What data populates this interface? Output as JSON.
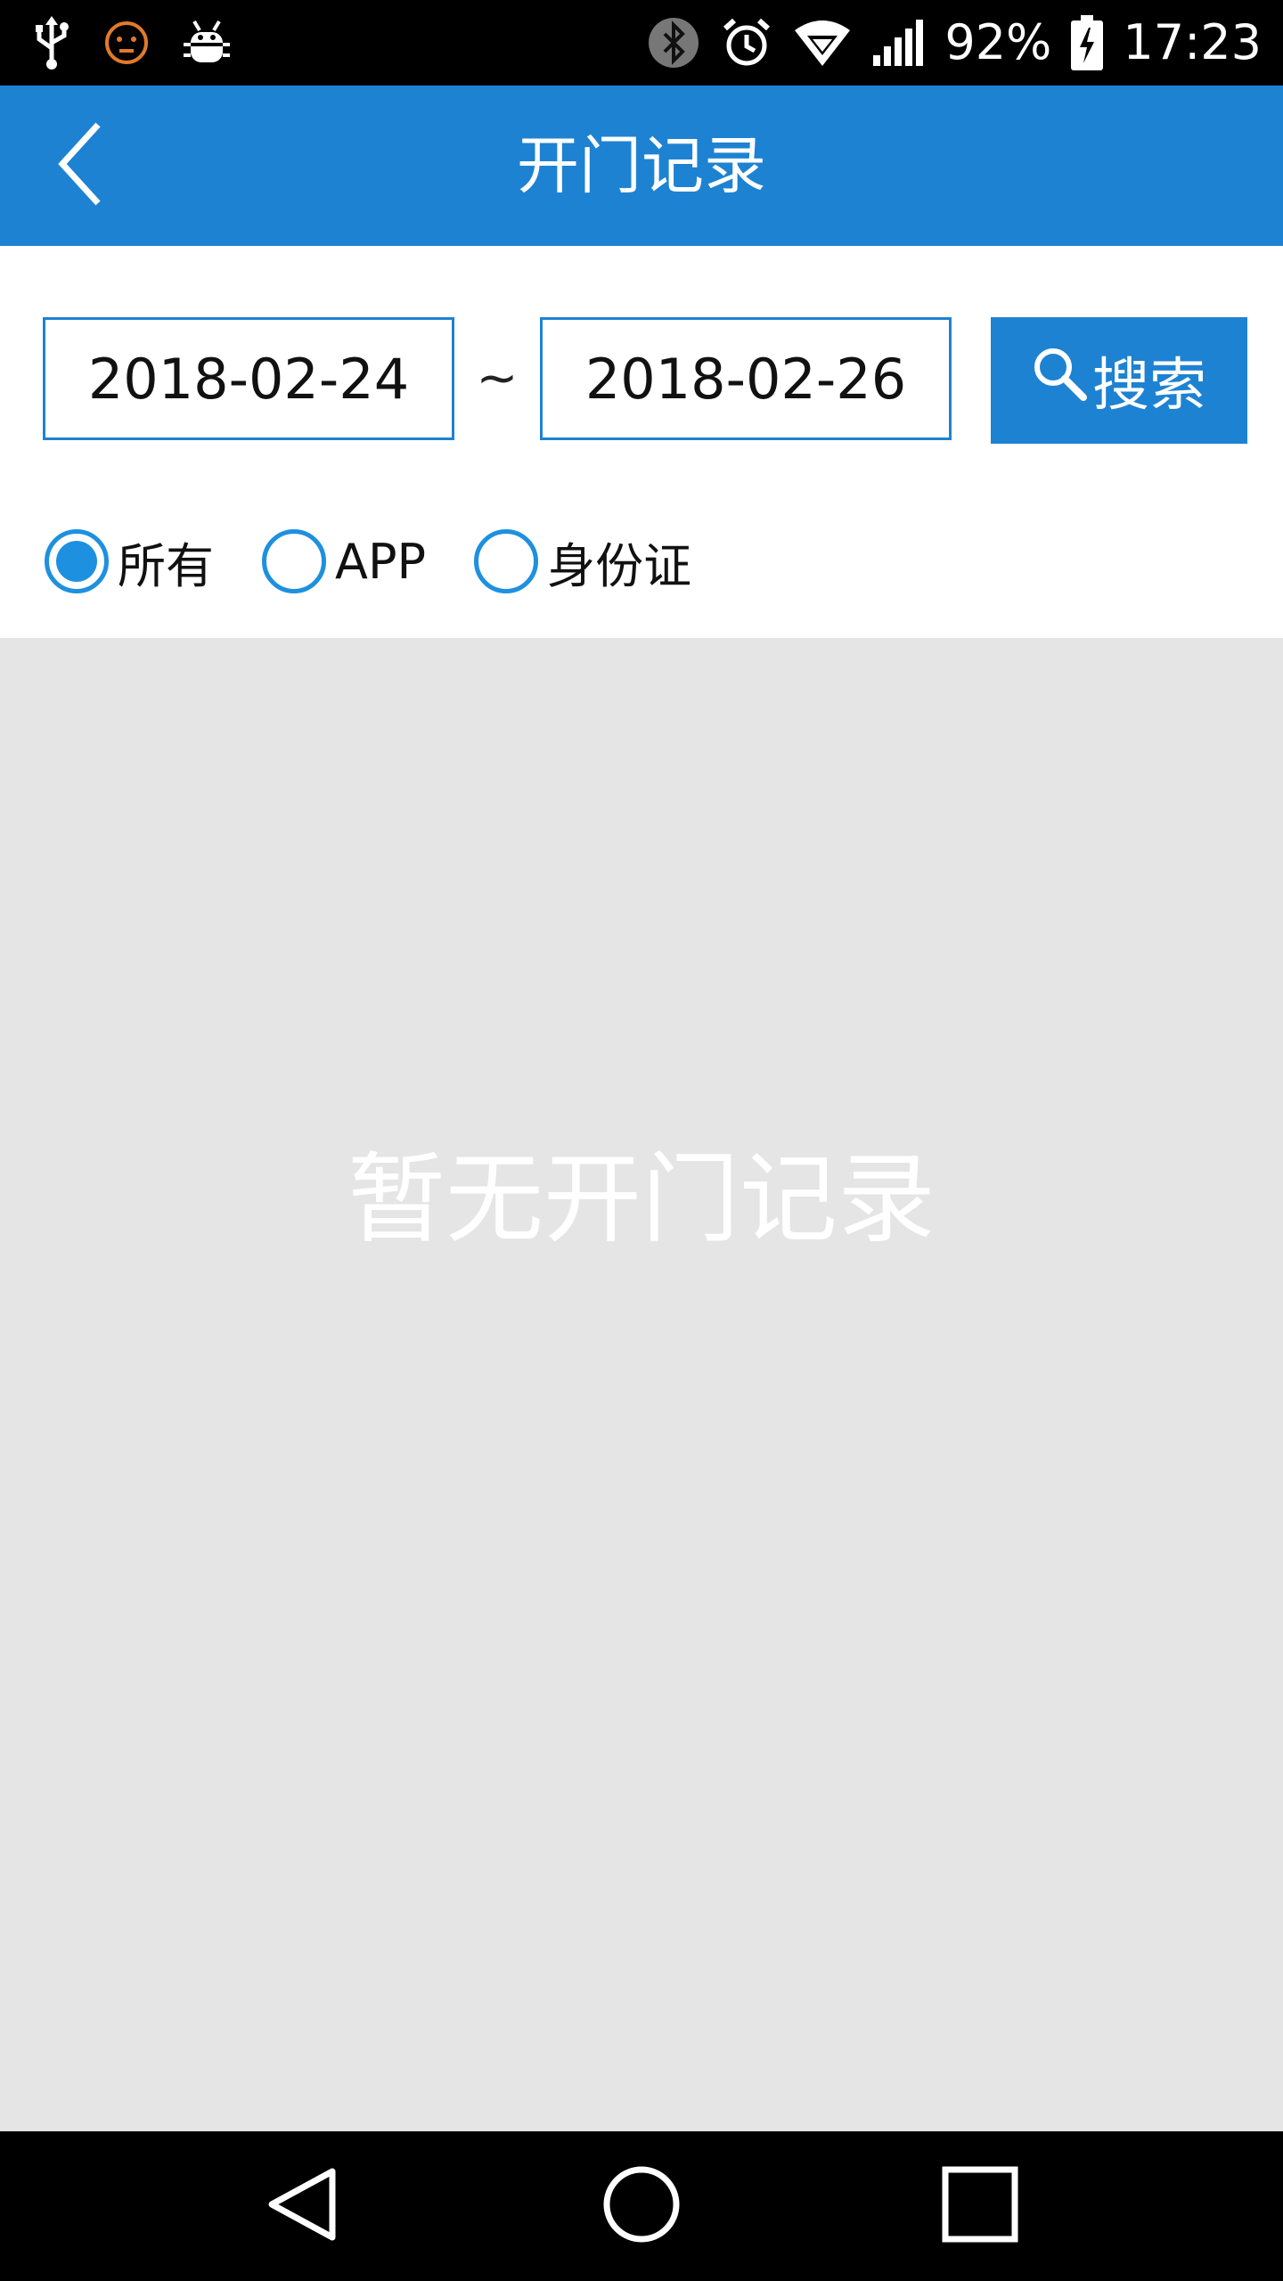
{
  "status_bar": {
    "battery_percent": "92%",
    "time": "17:23",
    "icons": [
      "usb-icon",
      "face-icon",
      "android-debug-icon",
      "bluetooth-icon",
      "alarm-icon",
      "wifi-icon",
      "signal-icon",
      "battery-charging-icon"
    ]
  },
  "app_bar": {
    "title": "开门记录",
    "back_icon": "chevron-left-icon"
  },
  "filter": {
    "start_date": "2018-02-24",
    "separator": "~",
    "end_date": "2018-02-26",
    "search_label": "搜索",
    "search_icon": "search-icon",
    "options": [
      {
        "label": "所有",
        "selected": true
      },
      {
        "label": "APP",
        "selected": false
      },
      {
        "label": "身份证",
        "selected": false
      }
    ]
  },
  "content": {
    "empty_message": "暂无开门记录"
  },
  "nav_bar": {
    "icons": [
      "nav-back-icon",
      "nav-home-icon",
      "nav-recents-icon"
    ]
  },
  "colors": {
    "primary": "#1e82d2",
    "radio": "#1e90e0",
    "background": "#e5e5e5"
  }
}
